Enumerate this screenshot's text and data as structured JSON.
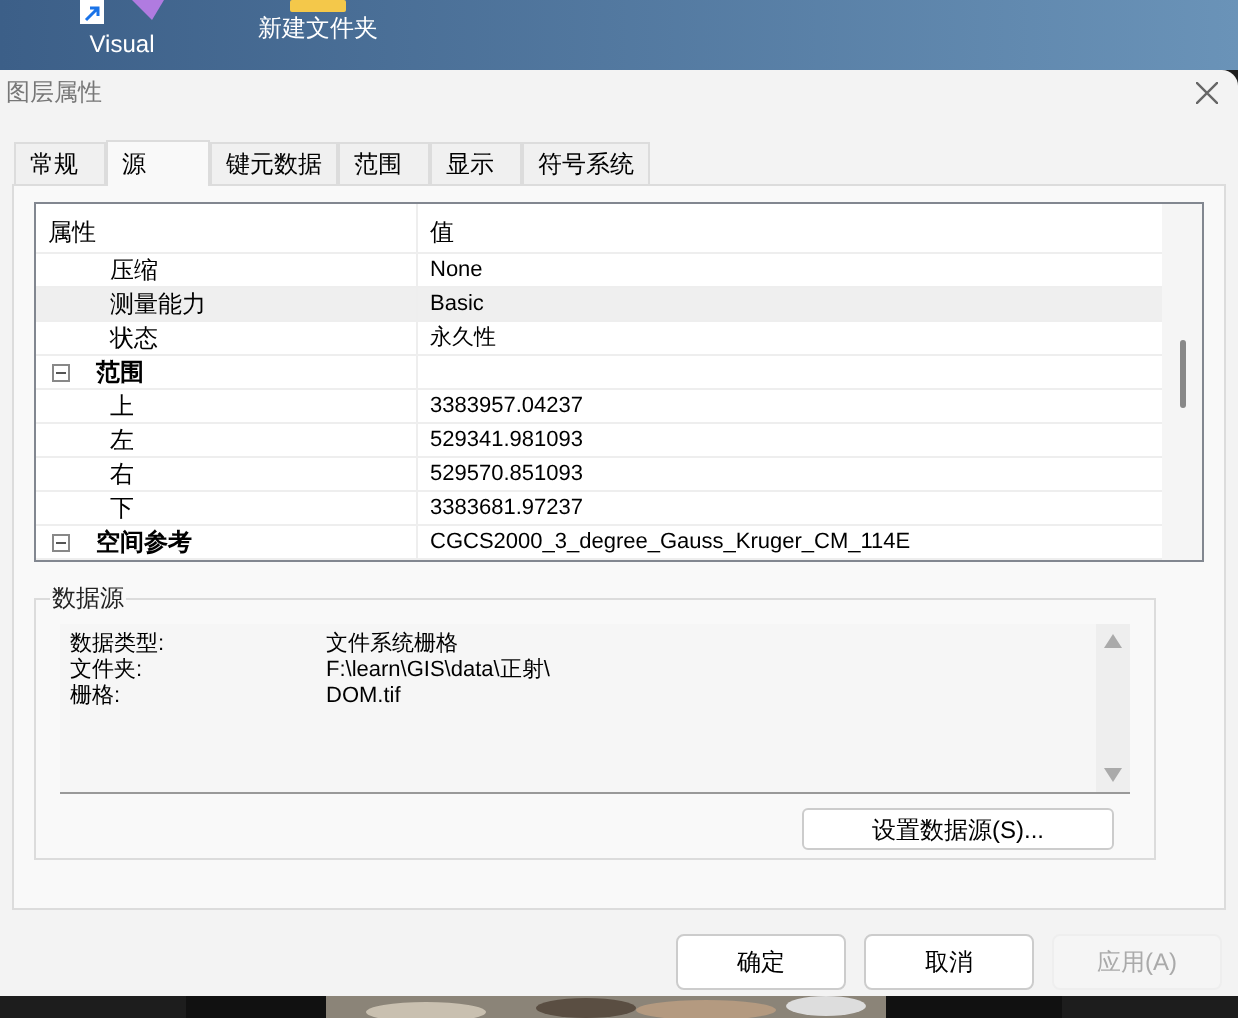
{
  "desktop": {
    "icons": [
      {
        "label": "Visual"
      },
      {
        "label": "新建文件夹"
      }
    ]
  },
  "window": {
    "title": "图层属性"
  },
  "tabs": [
    {
      "label": "常规",
      "selected": false
    },
    {
      "label": "源",
      "selected": true
    },
    {
      "label": "键元数据",
      "selected": false
    },
    {
      "label": "范围",
      "selected": false
    },
    {
      "label": "显示",
      "selected": false
    },
    {
      "label": "符号系统",
      "selected": false
    }
  ],
  "property_grid": {
    "columns": [
      "属性",
      "值"
    ],
    "rows": [
      {
        "kind": "property",
        "name": "压缩",
        "value": "None",
        "selected": false
      },
      {
        "kind": "property",
        "name": "测量能力",
        "value": "Basic",
        "selected": true
      },
      {
        "kind": "property",
        "name": "状态",
        "value": "永久性",
        "selected": false
      },
      {
        "kind": "category",
        "name": "范围",
        "expanded": true,
        "selected": false
      },
      {
        "kind": "property",
        "name": "上",
        "value": "3383957.04237",
        "selected": false
      },
      {
        "kind": "property",
        "name": "左",
        "value": "529341.981093",
        "selected": false
      },
      {
        "kind": "property",
        "name": "右",
        "value": "529570.851093",
        "selected": false
      },
      {
        "kind": "property",
        "name": "下",
        "value": "3383681.97237",
        "selected": false
      },
      {
        "kind": "category",
        "name": "空间参考",
        "value": "CGCS2000_3_degree_Gauss_Kruger_CM_114E",
        "expanded": true,
        "selected": false
      }
    ]
  },
  "data_source": {
    "title": "数据源",
    "entries": [
      {
        "label": "数据类型:",
        "value": "文件系统栅格"
      },
      {
        "label": "文件夹:",
        "value": "F:\\learn\\GIS\\data\\正射\\"
      },
      {
        "label": "栅格:",
        "value": "DOM.tif"
      }
    ],
    "button": "设置数据源(S)..."
  },
  "buttons": [
    {
      "label": "确定",
      "disabled": false
    },
    {
      "label": "取消",
      "disabled": false
    },
    {
      "label": "应用(A)",
      "disabled": true
    }
  ]
}
